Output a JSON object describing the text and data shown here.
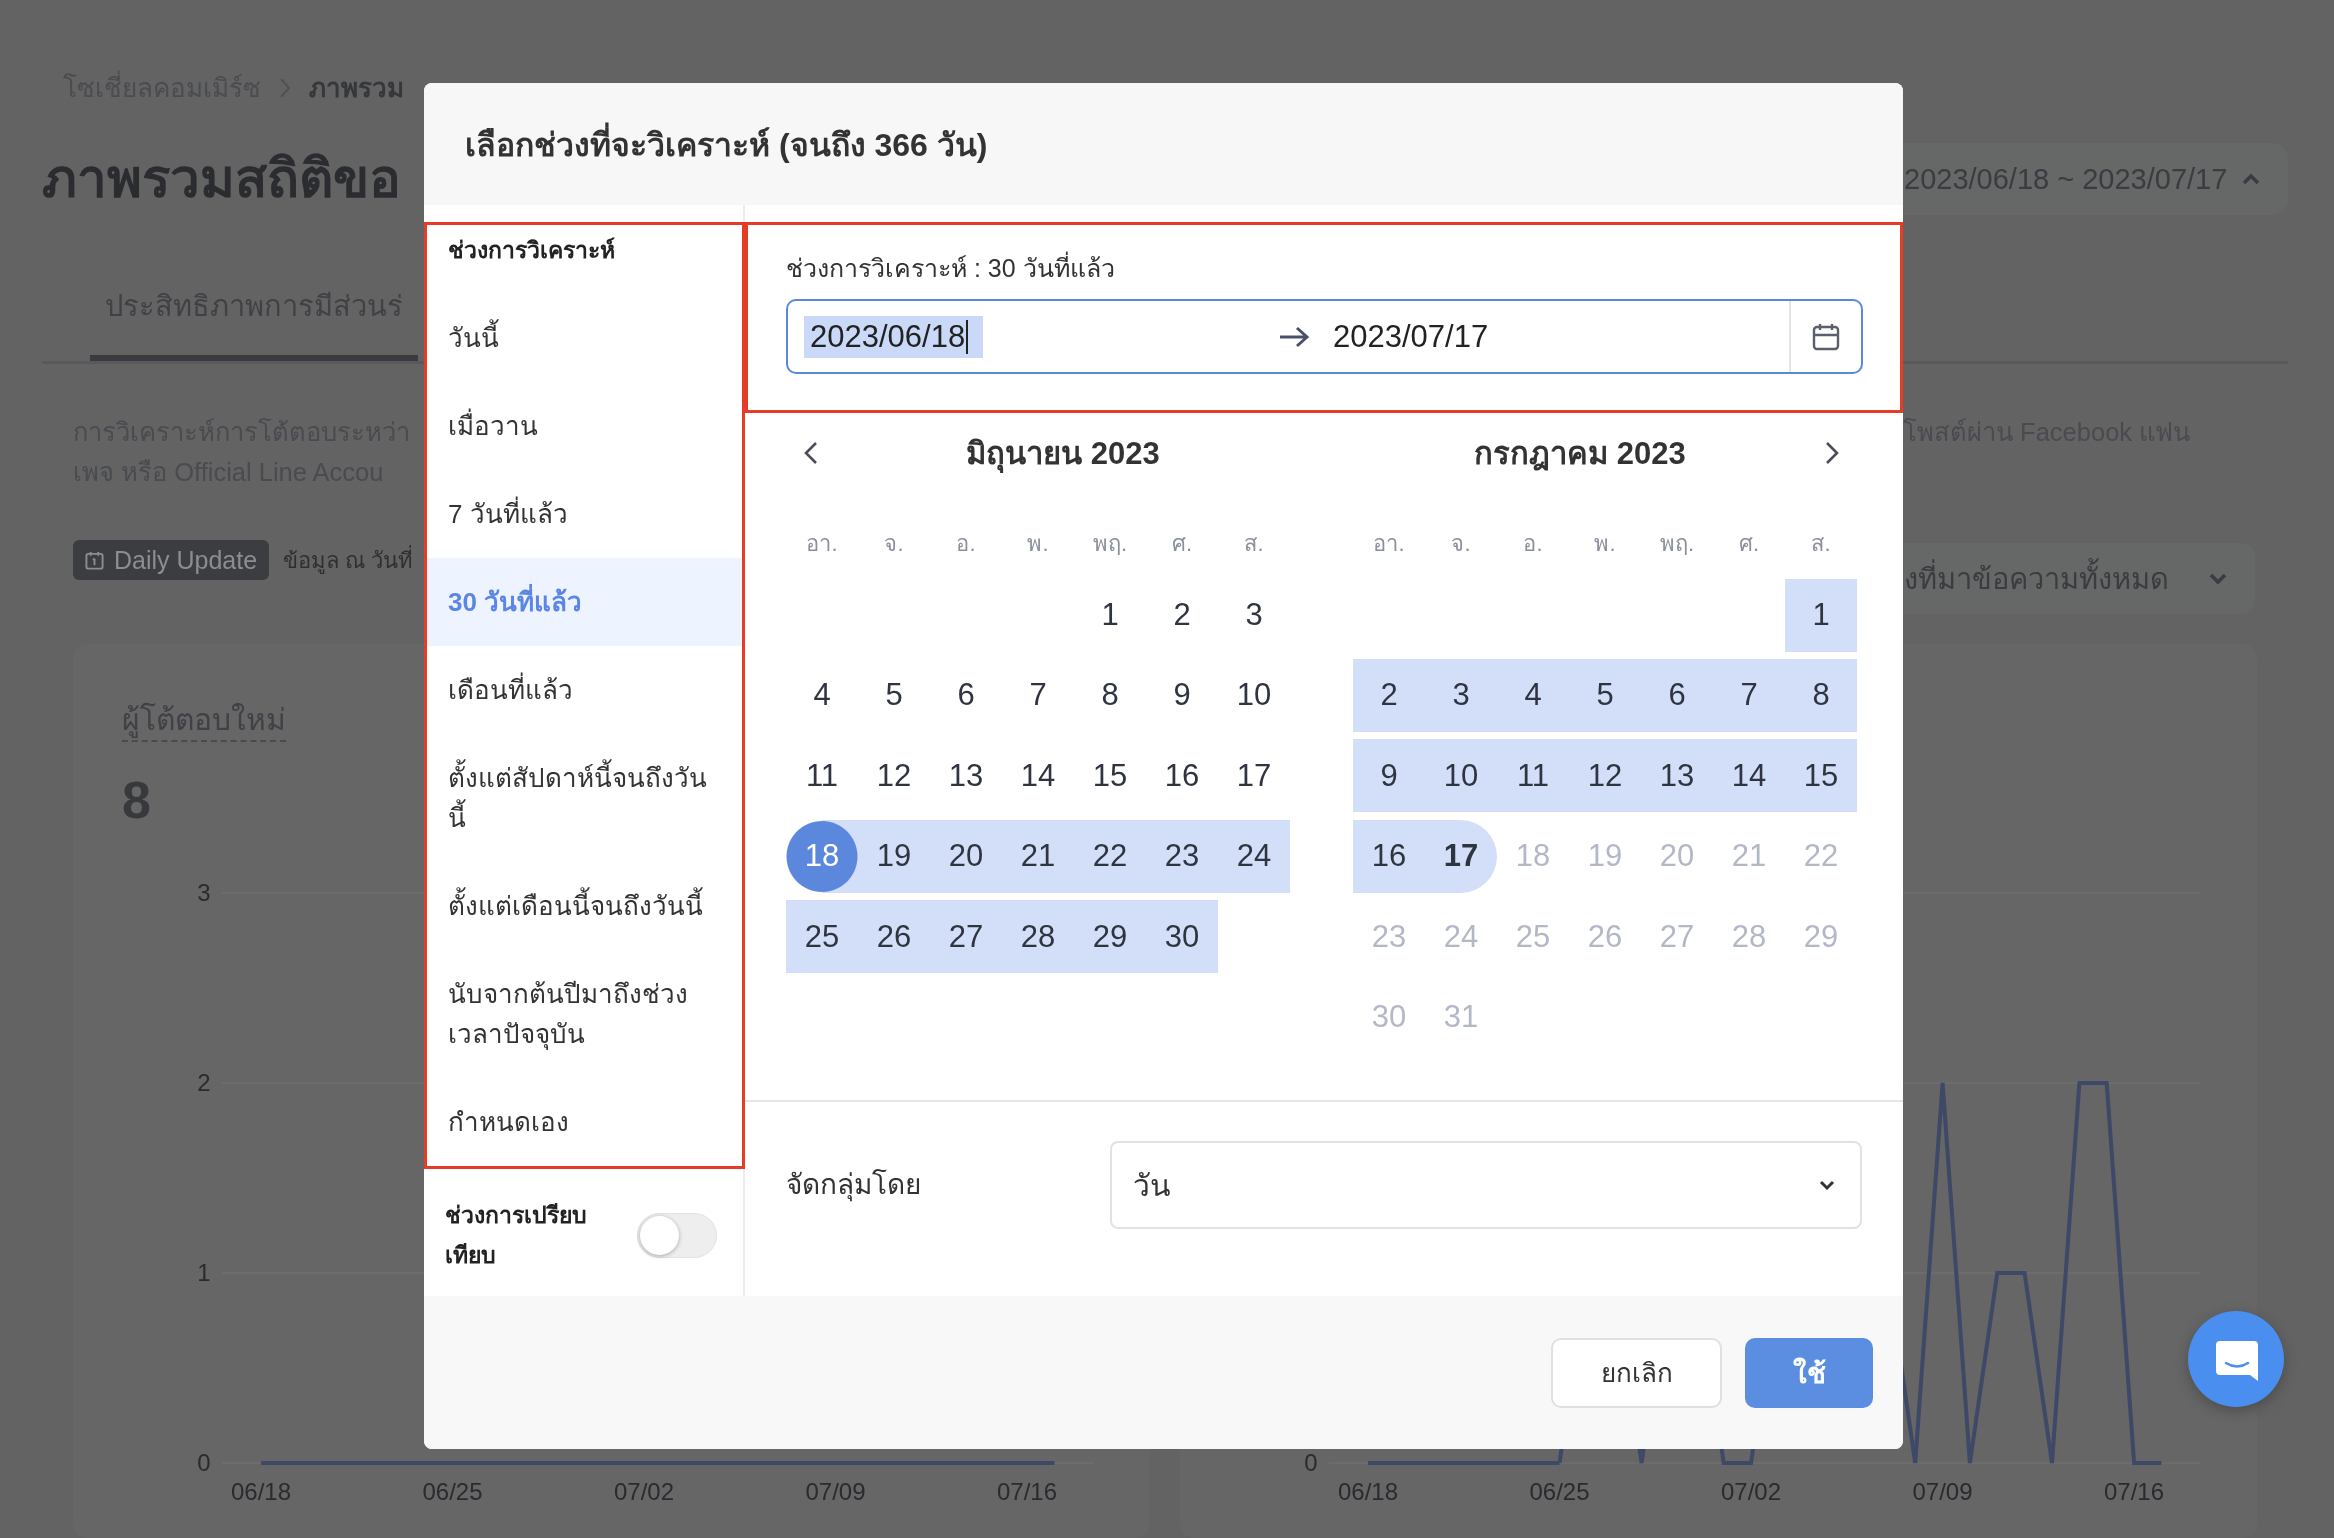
{
  "page": {
    "breadcrumb": [
      {
        "label": "โซเชี่ยลคอมเมิร์ซ",
        "current": false
      },
      {
        "label": "ภาพรวม",
        "current": true
      }
    ],
    "title": "ภาพรวมสถิติขอ",
    "date_range_button": {
      "label": "2023/06/18 ~ 2023/07/17",
      "expanded": true
    },
    "tabs": [
      {
        "label": "ประสิทธิภาพการมีส่วนร่",
        "selected": true
      }
    ],
    "description": {
      "lines": [
        "การวิเคราะห์การโต้ตอบระหว่า",
        "เพจ หรือ Official Line Accou"
      ],
      "continuation": "โพสต์ผ่าน Facebook แฟน"
    },
    "update_badge": {
      "label": "Daily Update"
    },
    "data_as_of": "ข้อมูล ณ วันที่",
    "source_filter": {
      "value": "งที่มาข้อความทั้งหมด",
      "expanded": false
    },
    "cards": [
      {
        "title": "ผู้โต้ตอบใหม่",
        "value": "8",
        "y_labels": [
          "3",
          "2",
          "1",
          "0"
        ],
        "x_labels": [
          "06/18",
          "06/25",
          "07/02",
          "07/09",
          "07/16"
        ]
      },
      {
        "y_labels": [
          "0"
        ],
        "x_labels": [
          "06/18",
          "06/25",
          "07/02",
          "07/09",
          "07/16"
        ]
      }
    ]
  },
  "dialog": {
    "title": "เลือกช่วงที่จะวิเคราะห์ (จนถึง 366 วัน)",
    "presets": {
      "heading": "ช่วงการวิเคราะห์",
      "items": [
        {
          "label": "วันนี้",
          "selected": false
        },
        {
          "label": "เมื่อวาน",
          "selected": false
        },
        {
          "label": "7 วันที่แล้ว",
          "selected": false
        },
        {
          "label": "30 วันที่แล้ว",
          "selected": true
        },
        {
          "label": "เดือนที่แล้ว",
          "selected": false
        },
        {
          "label": "ตั้งแต่สัปดาห์นี้จนถึงวันนี้",
          "selected": false
        },
        {
          "label": "ตั้งแต่เดือนนี้จนถึงวันนี้",
          "selected": false
        },
        {
          "label": "นับจากต้นปีมาถึงช่วงเวลาปัจจุบัน",
          "selected": false
        },
        {
          "label": "กำหนดเอง",
          "selected": false
        }
      ]
    },
    "comparison": {
      "label": "ช่วงการเปรียบเทียบ",
      "on": false
    },
    "range_label": "ช่วงการวิเคราะห์ : 30 วันที่แล้ว",
    "range_input": {
      "start": "2023/06/18",
      "start_focused": true,
      "end": "2023/07/17"
    },
    "months": [
      {
        "title": "มิถุนายน 2023",
        "weekdays": [
          "อา.",
          "จ.",
          "อ.",
          "พ.",
          "พฤ.",
          "ศ.",
          "ส."
        ],
        "weeks": [
          [
            {
              "label": "1",
              "kind": "day",
              "in_range": false,
              "disabled": false
            },
            {
              "label": "2",
              "kind": "day",
              "in_range": false,
              "disabled": false
            },
            {
              "label": "3",
              "kind": "day",
              "in_range": false,
              "disabled": false
            }
          ],
          [
            {
              "label": "4",
              "kind": "day",
              "in_range": false,
              "disabled": false
            },
            {
              "label": "5",
              "kind": "day",
              "in_range": false,
              "disabled": false
            },
            {
              "label": "6",
              "kind": "day",
              "in_range": false,
              "disabled": false
            },
            {
              "label": "7",
              "kind": "day",
              "in_range": false,
              "disabled": false
            },
            {
              "label": "8",
              "kind": "day",
              "in_range": false,
              "disabled": false
            },
            {
              "label": "9",
              "kind": "day",
              "in_range": false,
              "disabled": false
            },
            {
              "label": "10",
              "kind": "day",
              "in_range": false,
              "disabled": false
            }
          ],
          [
            {
              "label": "11",
              "kind": "day",
              "in_range": false,
              "disabled": false
            },
            {
              "label": "12",
              "kind": "day",
              "in_range": false,
              "disabled": false
            },
            {
              "label": "13",
              "kind": "day",
              "in_range": false,
              "disabled": false
            },
            {
              "label": "14",
              "kind": "day",
              "in_range": false,
              "disabled": false
            },
            {
              "label": "15",
              "kind": "day",
              "in_range": false,
              "disabled": false
            },
            {
              "label": "16",
              "kind": "day",
              "in_range": false,
              "disabled": false
            },
            {
              "label": "17",
              "kind": "day",
              "in_range": false,
              "disabled": false
            }
          ],
          [
            {
              "label": "18",
              "kind": "range_start",
              "in_range": true,
              "disabled": false
            },
            {
              "label": "19",
              "kind": "day",
              "in_range": true,
              "disabled": false
            },
            {
              "label": "20",
              "kind": "day",
              "in_range": true,
              "disabled": false
            },
            {
              "label": "21",
              "kind": "day",
              "in_range": true,
              "disabled": false
            },
            {
              "label": "22",
              "kind": "day",
              "in_range": true,
              "disabled": false
            },
            {
              "label": "23",
              "kind": "day",
              "in_range": true,
              "disabled": false
            },
            {
              "label": "24",
              "kind": "day",
              "in_range": true,
              "disabled": false
            }
          ],
          [
            {
              "label": "25",
              "kind": "day",
              "in_range": true,
              "disabled": false
            },
            {
              "label": "26",
              "kind": "day",
              "in_range": true,
              "disabled": false
            },
            {
              "label": "27",
              "kind": "day",
              "in_range": true,
              "disabled": false
            },
            {
              "label": "28",
              "kind": "day",
              "in_range": true,
              "disabled": false
            },
            {
              "label": "29",
              "kind": "day",
              "in_range": true,
              "disabled": false
            },
            {
              "label": "30",
              "kind": "day",
              "in_range": true,
              "disabled": false
            }
          ]
        ]
      },
      {
        "title": "กรกฎาคม 2023",
        "weekdays": [
          "อา.",
          "จ.",
          "อ.",
          "พ.",
          "พฤ.",
          "ศ.",
          "ส."
        ],
        "weeks": [
          [
            {
              "label": "1",
              "kind": "day",
              "in_range": true,
              "disabled": false
            }
          ],
          [
            {
              "label": "2",
              "kind": "day",
              "in_range": true,
              "disabled": false
            },
            {
              "label": "3",
              "kind": "day",
              "in_range": true,
              "disabled": false
            },
            {
              "label": "4",
              "kind": "day",
              "in_range": true,
              "disabled": false
            },
            {
              "label": "5",
              "kind": "day",
              "in_range": true,
              "disabled": false
            },
            {
              "label": "6",
              "kind": "day",
              "in_range": true,
              "disabled": false
            },
            {
              "label": "7",
              "kind": "day",
              "in_range": true,
              "disabled": false
            },
            {
              "label": "8",
              "kind": "day",
              "in_range": true,
              "disabled": false
            }
          ],
          [
            {
              "label": "9",
              "kind": "day",
              "in_range": true,
              "disabled": false
            },
            {
              "label": "10",
              "kind": "day",
              "in_range": true,
              "disabled": false
            },
            {
              "label": "11",
              "kind": "day",
              "in_range": true,
              "disabled": false
            },
            {
              "label": "12",
              "kind": "day",
              "in_range": true,
              "disabled": false
            },
            {
              "label": "13",
              "kind": "day",
              "in_range": true,
              "disabled": false
            },
            {
              "label": "14",
              "kind": "day",
              "in_range": true,
              "disabled": false
            },
            {
              "label": "15",
              "kind": "day",
              "in_range": true,
              "disabled": false
            }
          ],
          [
            {
              "label": "16",
              "kind": "day",
              "in_range": true,
              "disabled": false
            },
            {
              "label": "17",
              "kind": "range_end",
              "in_range": true,
              "disabled": false
            },
            {
              "label": "18",
              "kind": "day",
              "in_range": false,
              "disabled": true
            },
            {
              "label": "19",
              "kind": "day",
              "in_range": false,
              "disabled": true
            },
            {
              "label": "20",
              "kind": "day",
              "in_range": false,
              "disabled": true
            },
            {
              "label": "21",
              "kind": "day",
              "in_range": false,
              "disabled": true
            },
            {
              "label": "22",
              "kind": "day",
              "in_range": false,
              "disabled": true
            }
          ],
          [
            {
              "label": "23",
              "kind": "day",
              "in_range": false,
              "disabled": true
            },
            {
              "label": "24",
              "kind": "day",
              "in_range": false,
              "disabled": true
            },
            {
              "label": "25",
              "kind": "day",
              "in_range": false,
              "disabled": true
            },
            {
              "label": "26",
              "kind": "day",
              "in_range": false,
              "disabled": true
            },
            {
              "label": "27",
              "kind": "day",
              "in_range": false,
              "disabled": true
            },
            {
              "label": "28",
              "kind": "day",
              "in_range": false,
              "disabled": true
            },
            {
              "label": "29",
              "kind": "day",
              "in_range": false,
              "disabled": true
            }
          ],
          [
            {
              "label": "30",
              "kind": "day",
              "in_range": false,
              "disabled": true
            },
            {
              "label": "31",
              "kind": "day",
              "in_range": false,
              "disabled": true
            }
          ]
        ]
      }
    ],
    "group_by": {
      "label": "จัดกลุ่มโดย",
      "value": "วัน",
      "expanded": false
    },
    "buttons": [
      {
        "label": "ยกเลิก",
        "kind": "secondary"
      },
      {
        "label": "ใช้",
        "kind": "primary"
      }
    ]
  }
}
